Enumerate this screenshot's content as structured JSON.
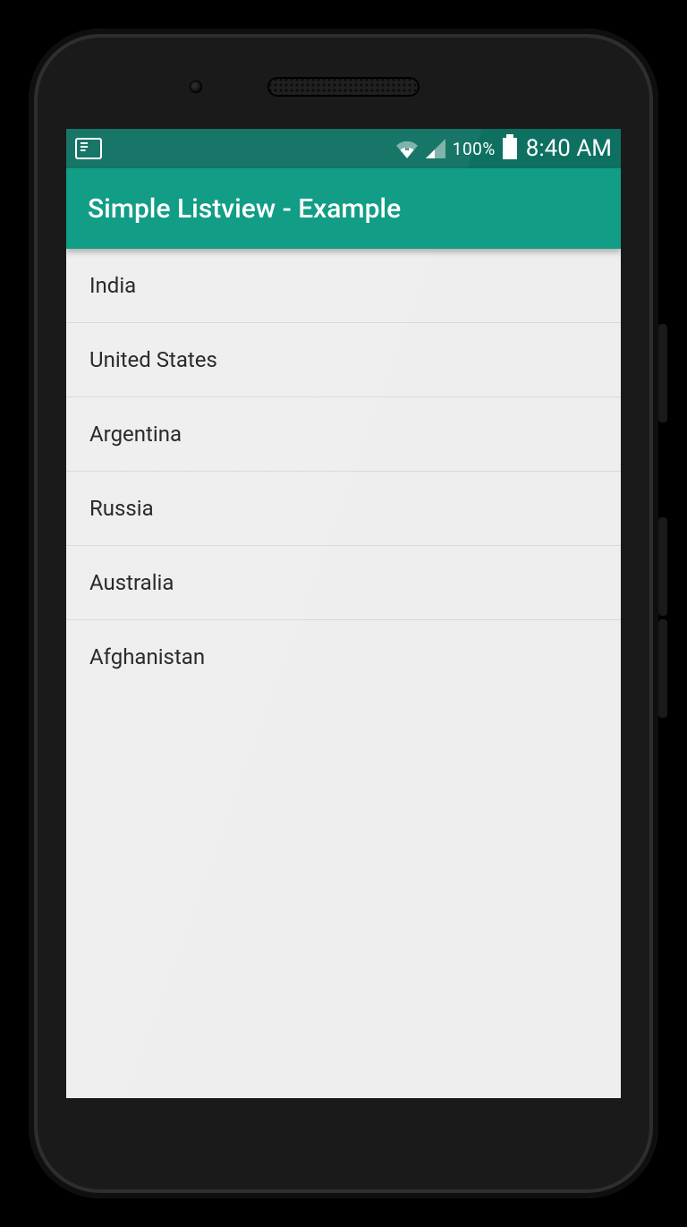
{
  "status_bar": {
    "battery_percent": "100%",
    "time": "8:40 AM"
  },
  "app_bar": {
    "title": "Simple Listview - Example"
  },
  "list": {
    "items": [
      {
        "label": "India"
      },
      {
        "label": "United States"
      },
      {
        "label": "Argentina"
      },
      {
        "label": "Russia"
      },
      {
        "label": "Australia"
      },
      {
        "label": "Afghanistan"
      }
    ]
  },
  "colors": {
    "status_bar_bg": "#0e7061",
    "app_bar_bg": "#119d86",
    "screen_bg": "#eeeeee"
  }
}
